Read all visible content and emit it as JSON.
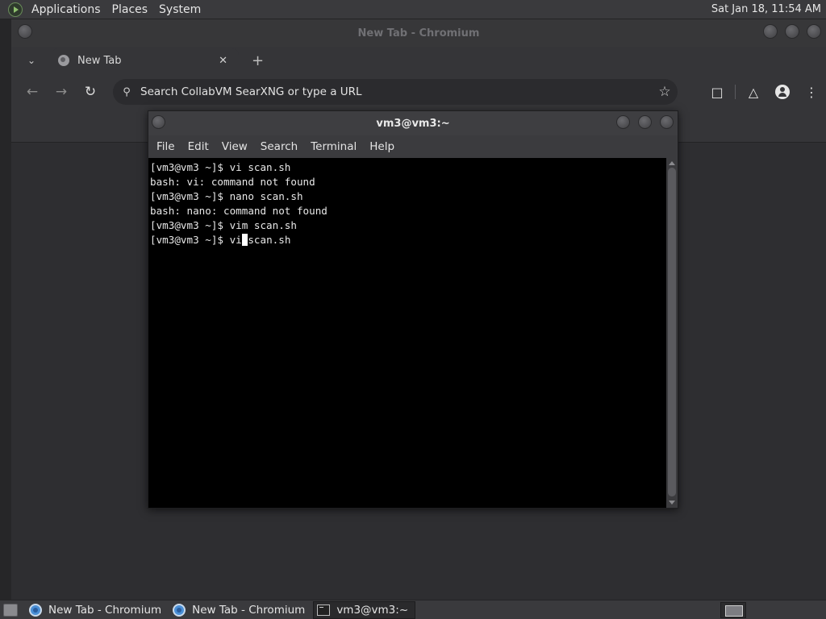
{
  "top_panel": {
    "menus": [
      "Applications",
      "Places",
      "System"
    ],
    "clock": "Sat Jan 18, 11:54 AM"
  },
  "browser": {
    "window_title": "New Tab - Chromium",
    "tab": {
      "title": "New Tab"
    },
    "omnibox_placeholder": "Search CollabVM SearXNG or type a URL"
  },
  "terminal": {
    "window_title": "vm3@vm3:~",
    "menu": [
      "File",
      "Edit",
      "View",
      "Search",
      "Terminal",
      "Help"
    ],
    "lines": [
      "[vm3@vm3 ~]$ vi scan.sh",
      "bash: vi: command not found",
      "[vm3@vm3 ~]$ nano scan.sh",
      "bash: nano: command not found",
      "[vm3@vm3 ~]$ vim scan.sh"
    ],
    "current_prompt": "[vm3@vm3 ~]$ vi",
    "current_after_cursor": "scan.sh"
  },
  "taskbar": {
    "tasks": [
      {
        "label": "New Tab - Chromium",
        "icon": "chromium-icon",
        "active": false
      },
      {
        "label": "New Tab - Chromium",
        "icon": "chromium-icon",
        "active": false
      },
      {
        "label": "vm3@vm3:~",
        "icon": "terminal-icon",
        "active": true
      }
    ]
  }
}
